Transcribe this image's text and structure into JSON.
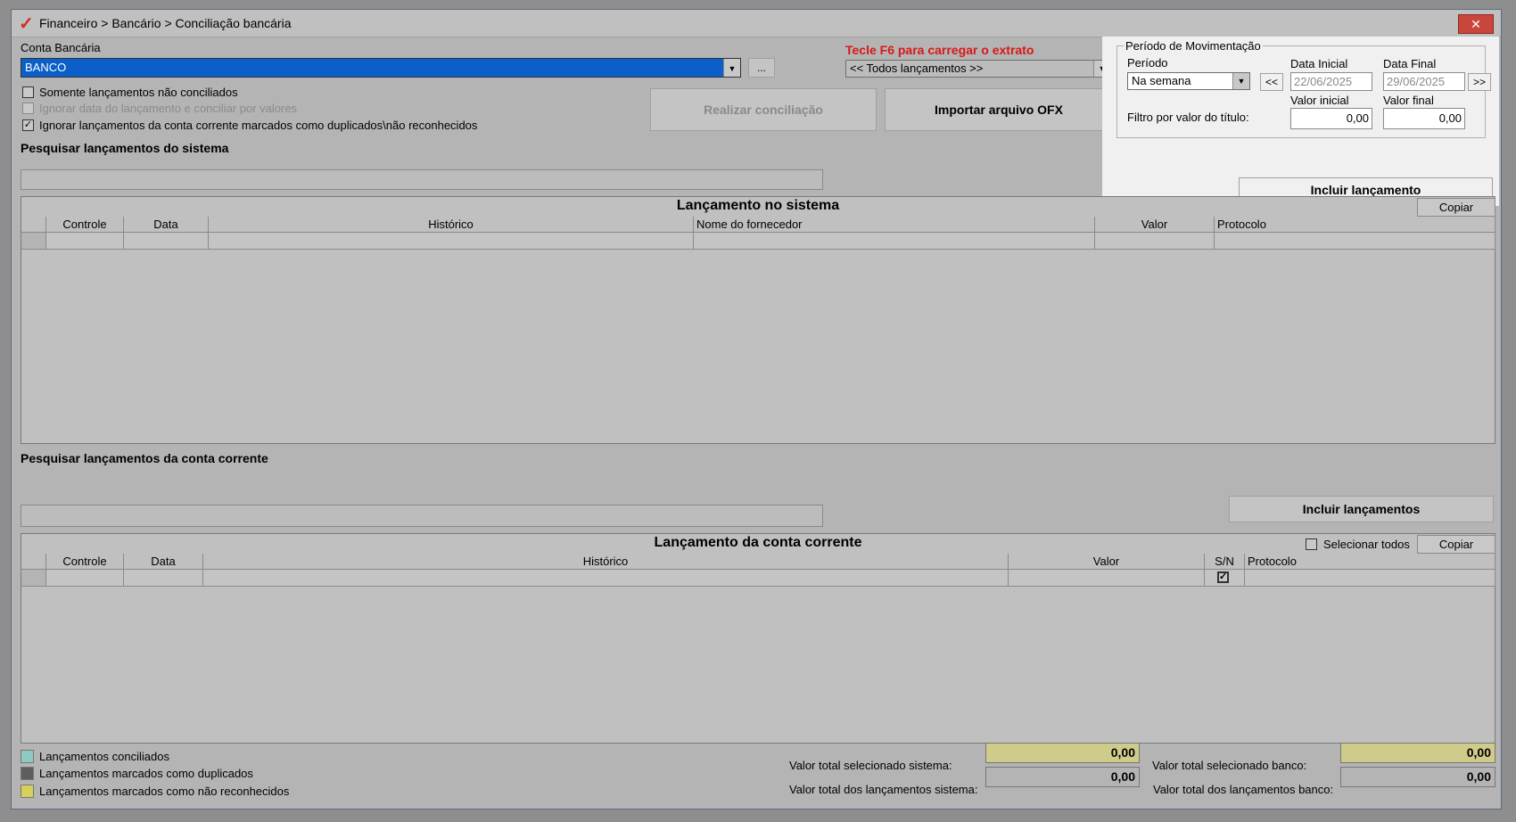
{
  "window": {
    "title": "Financeiro > Bancário > Conciliação bancária",
    "close_label": "✕"
  },
  "account": {
    "label": "Conta Bancária",
    "value": "BANCO",
    "browse_label": "..."
  },
  "f6_hint": "Tecle F6 para carregar o extrato",
  "filter_combo": {
    "value": "<< Todos lançamentos >>"
  },
  "options": [
    {
      "label": "Somente lançamentos não conciliados",
      "checked": false,
      "disabled": false
    },
    {
      "label": "Ignorar data do lançamento e conciliar por valores",
      "checked": false,
      "disabled": true
    },
    {
      "label": "Ignorar lançamentos da conta corrente marcados como duplicados\\não reconhecidos",
      "checked": true,
      "disabled": false
    }
  ],
  "buttons": {
    "realizar": "Realizar conciliação",
    "importar": "Importar arquivo OFX",
    "incluir_lancamento": "Incluir lançamento",
    "incluir_lancamentos": "Incluir lançamentos"
  },
  "period": {
    "group_label": "Período de Movimentação",
    "periodo_label": "Período",
    "periodo_value": "Na semana",
    "prev_label": "<<",
    "next_label": ">>",
    "data_inicial_label": "Data Inicial",
    "data_inicial": "22/06/2025",
    "data_final_label": "Data Final",
    "data_final": "29/06/2025",
    "valor_inicial_label": "Valor inicial",
    "valor_final_label": "Valor final",
    "filtro_label": "Filtro por valor do título:",
    "valor_inicial": "0,00",
    "valor_final": "0,00"
  },
  "system_search": {
    "label": "Pesquisar lançamentos do sistema",
    "value": ""
  },
  "system_grid": {
    "title": "Lançamento no sistema",
    "copy_label": "Copiar",
    "columns": [
      "Controle",
      "Data",
      "Histórico",
      "Nome do fornecedor",
      "Valor",
      "Protocolo"
    ]
  },
  "account_search": {
    "label": "Pesquisar lançamentos da conta corrente",
    "value": ""
  },
  "account_grid": {
    "title": "Lançamento da conta corrente",
    "select_all_label": "Selecionar todos",
    "copy_label": "Copiar",
    "columns": [
      "Controle",
      "Data",
      "Histórico",
      "Valor",
      "S/N",
      "Protocolo"
    ]
  },
  "legend": [
    {
      "label": "Lançamentos conciliados",
      "color": "#8fc9c3"
    },
    {
      "label": "Lançamentos marcados como duplicados",
      "color": "#5e5e5e"
    },
    {
      "label": "Lançamentos marcados como não reconhecidos",
      "color": "#d6cf5c"
    }
  ],
  "totals": {
    "sel_sistema_label": "Valor total selecionado sistema:",
    "sel_sistema": "0,00",
    "tot_sistema_label": "Valor total dos lançamentos sistema:",
    "tot_sistema": "0,00",
    "sel_banco_label": "Valor total selecionado banco:",
    "sel_banco": "0,00",
    "tot_banco_label": "Valor total dos lançamentos banco:",
    "tot_banco": "0,00"
  },
  "colors": {
    "selection": "#0a5fc8",
    "hint": "#d81818",
    "highlight": "#cfcb8a"
  }
}
